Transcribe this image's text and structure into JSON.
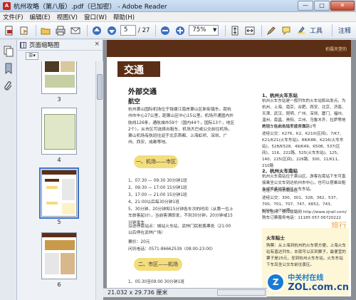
{
  "window": {
    "title": "杭州攻略（第八版）.pdf（已加密） - Adobe Reader",
    "minimize": "—",
    "maximize": "□",
    "close": "✕"
  },
  "menu": [
    "文件(F)",
    "编辑(E)",
    "视图(V)",
    "窗口(W)",
    "帮助(H)"
  ],
  "toolbar": {
    "page_current": "5",
    "page_total": "/ 27",
    "zoom": "75%",
    "tools": "工具",
    "comment": "注释"
  },
  "panel": {
    "title": "页面缩略图",
    "close": "×",
    "thumbnails": [
      {
        "page": "3"
      },
      {
        "page": "4"
      },
      {
        "page": "5",
        "selected": true
      },
      {
        "page": "6"
      }
    ]
  },
  "page": {
    "section": "交通",
    "corner_text": "拍摄天堂的",
    "heading": "外部交通",
    "sub_air": "航空",
    "air_text": "杭州萧山国际机场位于钱塘江南岸萧山区新街镇东，距杭州市中心27公里，距萧山区中心15公里。机场开通国内外航线126条，通航城市59个（国内44个，国际13个，地区2个）。从市区可选择出租车、机场大巴或公交前往机场，萧山机场有航班往返于北京首都、上海虹桥、深圳、广州、西安、成都等地。",
    "route1": "一、机场——市区",
    "schedule": [
      "1、07:30 — 09:30  30分钟1班",
      "2、09:30 — 17:00  15分钟1班",
      "3、17:00 — 21:00  15分钟1班",
      "4、21:00以后每30分钟1班",
      "5、30分钟、20分钟和15分钟各车次的时间（从第一位上车旅客起计），当前客满即发，不到30分钟，20分钟或15分钟发车"
    ],
    "stop_text": "沿途停靠站点：城站火车站、武林门民航售票处（21:00以后停在武林广场）",
    "fare": "票价：20元",
    "phone": "问讯电话：0571-86662539（08:00-23:00）",
    "route2": "二、市区——机场",
    "schedule2": "1、05:30至09:00  30分钟1班",
    "right_h1": "1、杭州火车东站",
    "right_p1": "杭州火车东站是一般列车的火车站和出发点，为杭州、上海、南京、合肥、西安、北京、济南、天津、武汉、昆明、广州、深圳、厦门、福州、温州、南昌、贵阳、兰州、乌鲁木齐、拉萨等地的列车在此站始发或停靠。",
    "right_addr": "地址：杭州市江干区天城路1号",
    "right_lines": "途经公交：K276、K2、K210(区间)、7/K7、K21/K21(火车东站)、88/K88、K216(火车东站)、528/K528、49/K49、K508、537(区间)、116、222路、525(火车东站)、125、140、225(区间)、226路、300、11/K11、210路",
    "right_h2": "2、杭州火车南站",
    "right_p2": "杭州火车南站位于萧山区，游客在南站下车可直接乘坐公交车到达杭州市中心，也可以搭乘出租车或换乘地铁前往火车东站。",
    "right_addr2": "地址：杭州市萧山区",
    "right_lines2": "途经公交：300、301、328、362、537、700、701、707、747、K652、743、K706、K726路",
    "right_web": "购车官网：浙江铁路网 http://www.zjrail.com/",
    "right_phone": "购车订票服务电话：11185  057-56720222",
    "side_title": "旅行",
    "tip_title": "火车贴士",
    "tip_text": "购票：从上海到杭州的火车很方便，上海火车站有直达列车，去就可以买到票子，最便宜的票子是25元，坐到杭州火车东站，火车东站下车后坐公交车前往景区。"
  },
  "status": {
    "size": "21.032 x 29.736 厘米"
  },
  "watermark": {
    "line1": "中关村在线",
    "line2": "ZOL.com.cn"
  }
}
